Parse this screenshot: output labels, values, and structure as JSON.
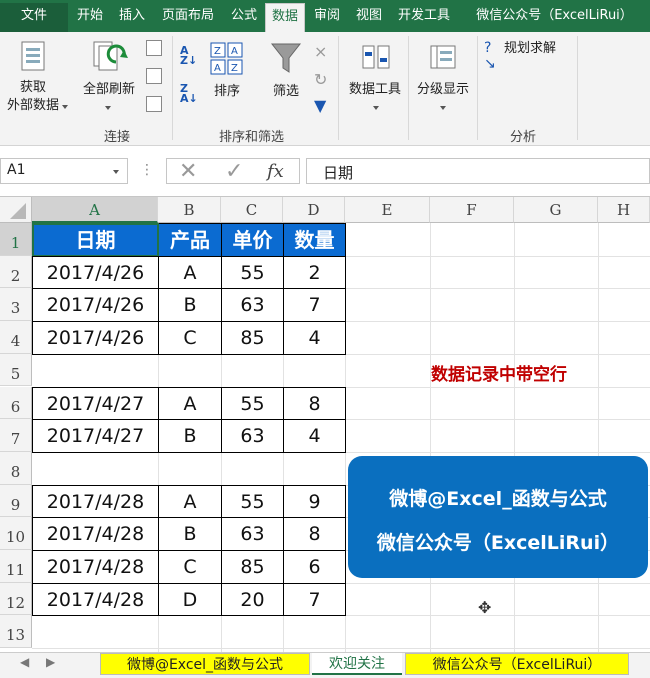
{
  "tabs": [
    "文件",
    "开始",
    "插入",
    "页面布局",
    "公式",
    "数据",
    "审阅",
    "视图",
    "开发工具",
    "微信公众号（ExcelLiRui）"
  ],
  "ribbon": {
    "get_external_1": "获取",
    "get_external_2": "外部数据",
    "refresh_all": "全部刷新",
    "sort": "排序",
    "filter": "筛选",
    "data_tools": "数据工具",
    "outline": "分级显示",
    "solver": "规划求解",
    "group_connections": "连接",
    "group_sort_filter": "排序和筛选",
    "group_analysis": "分析"
  },
  "formula_bar": {
    "name_box": "A1",
    "fx": "fx",
    "content": "日期"
  },
  "columns": [
    "A",
    "B",
    "C",
    "D",
    "E",
    "F",
    "G",
    "H"
  ],
  "rows": [
    "1",
    "2",
    "3",
    "4",
    "5",
    "6",
    "7",
    "8",
    "9",
    "10",
    "11",
    "12",
    "13"
  ],
  "table": {
    "headers": [
      "日期",
      "产品",
      "单价",
      "数量"
    ],
    "groups": [
      [
        [
          "2017/4/26",
          "A",
          "55",
          "2"
        ],
        [
          "2017/4/26",
          "B",
          "63",
          "7"
        ],
        [
          "2017/4/26",
          "C",
          "85",
          "4"
        ]
      ],
      [
        [
          "2017/4/27",
          "A",
          "55",
          "8"
        ],
        [
          "2017/4/27",
          "B",
          "63",
          "4"
        ]
      ],
      [
        [
          "2017/4/28",
          "A",
          "55",
          "9"
        ],
        [
          "2017/4/28",
          "B",
          "63",
          "8"
        ],
        [
          "2017/4/28",
          "C",
          "85",
          "6"
        ],
        [
          "2017/4/28",
          "D",
          "20",
          "7"
        ]
      ]
    ]
  },
  "annotation": "数据记录中带空行",
  "banner": {
    "line1": "微博@Excel_函数与公式",
    "line2": "微信公众号（ExcelLiRui）"
  },
  "sheet_tabs": [
    "微博@Excel_函数与公式",
    "欢迎关注",
    "微信公众号（ExcelLiRui）"
  ],
  "colors": {
    "excel_green": "#217346",
    "header_blue": "#0b6bd1",
    "banner_blue": "#0a6fbf",
    "annotation_red": "#c00000",
    "sheet_tab_yellow": "#ffff00"
  }
}
